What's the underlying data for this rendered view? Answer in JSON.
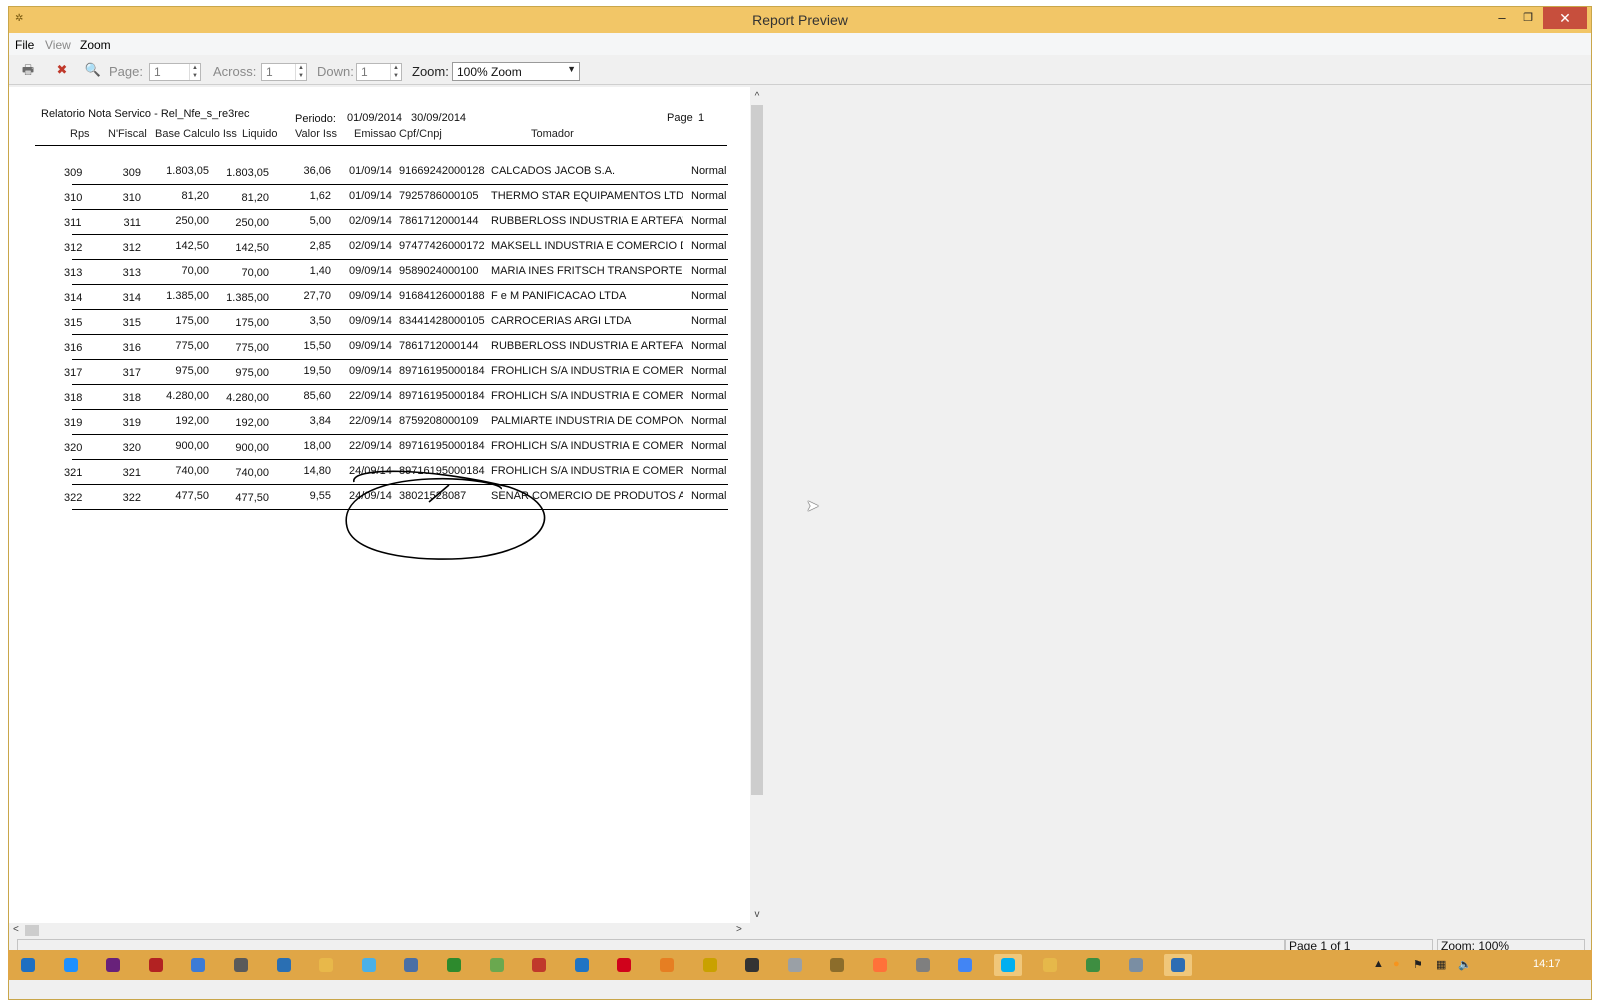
{
  "window": {
    "title": "Report Preview"
  },
  "menu": [
    "File",
    "View",
    "Zoom"
  ],
  "toolbar": {
    "page_label": "Page:",
    "page_value": "1",
    "across_label": "Across:",
    "across_value": "1",
    "down_label": "Down:",
    "down_value": "1",
    "zoom_label": "Zoom:",
    "zoom_value": "100% Zoom"
  },
  "report": {
    "title": "Relatorio Nota Servico - Rel_Nfe_s_re3rec",
    "periodo_label": "Periodo:",
    "period_start": "01/09/2014",
    "period_end": "30/09/2014",
    "page_label": "Page",
    "page_num": "1",
    "columns": [
      "Rps",
      "N'Fiscal",
      "Base Calculo Iss",
      "Liquido",
      "Valor Iss",
      "Emissao",
      "Cpf/Cnpj",
      "Tomador"
    ],
    "rows": [
      [
        "309",
        "309",
        "1.803,05",
        "1.803,05",
        "36,06",
        "01/09/14",
        "91669242000128",
        "CALCADOS JACOB S.A.",
        "Normal"
      ],
      [
        "310",
        "310",
        "81,20",
        "81,20",
        "1,62",
        "01/09/14",
        "7925786000105",
        "THERMO STAR EQUIPAMENTOS LTDA",
        "Normal"
      ],
      [
        "311",
        "311",
        "250,00",
        "250,00",
        "5,00",
        "02/09/14",
        "7861712000144",
        "RUBBERLOSS INDUSTRIA E ARTEFATOS I",
        "Normal"
      ],
      [
        "312",
        "312",
        "142,50",
        "142,50",
        "2,85",
        "02/09/14",
        "97477426000172",
        "MAKSELL INDUSTRIA E COMERCIO DE MA",
        "Normal"
      ],
      [
        "313",
        "313",
        "70,00",
        "70,00",
        "1,40",
        "09/09/14",
        "9589024000100",
        "MARIA INES FRITSCH TRANSPORTES",
        "Normal"
      ],
      [
        "314",
        "314",
        "1.385,00",
        "1.385,00",
        "27,70",
        "09/09/14",
        "91684126000188",
        "F e M PANIFICACAO LTDA",
        "Normal"
      ],
      [
        "315",
        "315",
        "175,00",
        "175,00",
        "3,50",
        "09/09/14",
        "83441428000105",
        "CARROCERIAS ARGI LTDA",
        "Normal"
      ],
      [
        "316",
        "316",
        "775,00",
        "775,00",
        "15,50",
        "09/09/14",
        "7861712000144",
        "RUBBERLOSS INDUSTRIA E ARTEFATOS I",
        "Normal"
      ],
      [
        "317",
        "317",
        "975,00",
        "975,00",
        "19,50",
        "09/09/14",
        "89716195000184",
        "FROHLICH S/A INDUSTRIA E COMERCIO DE",
        "Normal"
      ],
      [
        "318",
        "318",
        "4.280,00",
        "4.280,00",
        "85,60",
        "22/09/14",
        "89716195000184",
        "FROHLICH S/A INDUSTRIA E COMERCIO DE",
        "Normal"
      ],
      [
        "319",
        "319",
        "192,00",
        "192,00",
        "3,84",
        "22/09/14",
        "8759208000109",
        "PALMIARTE INDUSTRIA DE COMPONENTES",
        "Normal"
      ],
      [
        "320",
        "320",
        "900,00",
        "900,00",
        "18,00",
        "22/09/14",
        "89716195000184",
        "FROHLICH S/A INDUSTRIA E COMERCIO DE",
        "Normal"
      ],
      [
        "321",
        "321",
        "740,00",
        "740,00",
        "14,80",
        "24/09/14",
        "89716195000184",
        "FROHLICH S/A INDUSTRIA E COMERCIO DE",
        "Normal"
      ],
      [
        "322",
        "322",
        "477,50",
        "477,50",
        "9,55",
        "24/09/14",
        "38021528087",
        "SENAR COMERCIO DE PRODUTOS ALIMEN",
        "Normal"
      ]
    ]
  },
  "status": {
    "page_info": "Page 1 of 1",
    "zoom_info": "Zoom: 100%"
  },
  "taskbar": {
    "clock": "14:17",
    "icons": [
      "windows-start-icon",
      "internet-explorer-icon",
      "visual-studio-icon",
      "filezilla-icon",
      "remote-desktop-icon",
      "calculator-icon",
      "database-icon",
      "folder-app-icon",
      "notepad-icon",
      "network-icon",
      "terminal-icon",
      "android-icon",
      "access-icon",
      "browser-icon",
      "opera-icon",
      "matlab-icon",
      "editor-icon",
      "console-icon",
      "media-icon",
      "winamp-icon",
      "firefox-icon",
      "tool-icon",
      "chrome-icon",
      "skype-icon",
      "file-explorer-icon",
      "task-manager-icon",
      "settings-icon",
      "report-app-icon"
    ]
  }
}
